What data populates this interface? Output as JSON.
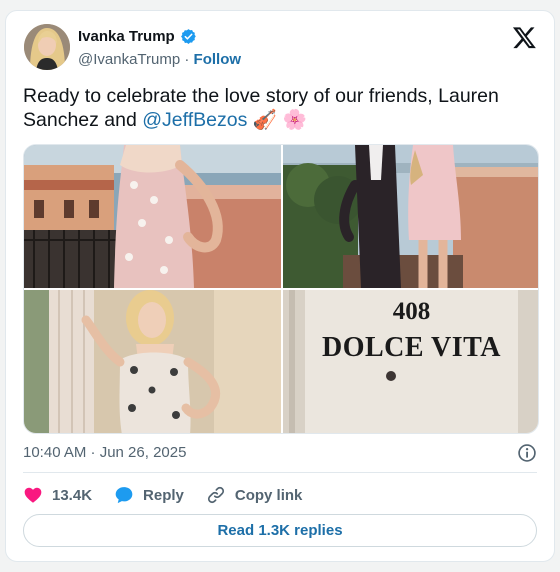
{
  "author": {
    "name": "Ivanka Trump",
    "handle": "@IvankaTrump",
    "separator": "·",
    "follow_label": "Follow",
    "verified": true
  },
  "tweet": {
    "text_before": "Ready to celebrate the love story of our friends, Lauren Sanchez and ",
    "mention": "@JeffBezos",
    "emoji": "🎻 🌸"
  },
  "media": {
    "photo_count": 4,
    "door_sign": {
      "number": "408",
      "name": "DOLCE VITA"
    }
  },
  "meta": {
    "timestamp": "10:40 AM · Jun 26, 2025"
  },
  "actions": {
    "likes_count": "13.4K",
    "reply_label": "Reply",
    "copy_link_label": "Copy link"
  },
  "read_replies_label": "Read 1.3K replies",
  "colors": {
    "link": "#1d6fa8",
    "heart": "#f91880",
    "reply_bubble": "#1d9bf0",
    "verified_badge": "#1d9bf0",
    "muted_text": "#536471",
    "border": "#e1e8ed"
  },
  "icons": [
    "verified-badge-icon",
    "x-logo-icon",
    "info-icon",
    "heart-icon",
    "reply-icon",
    "link-icon"
  ]
}
